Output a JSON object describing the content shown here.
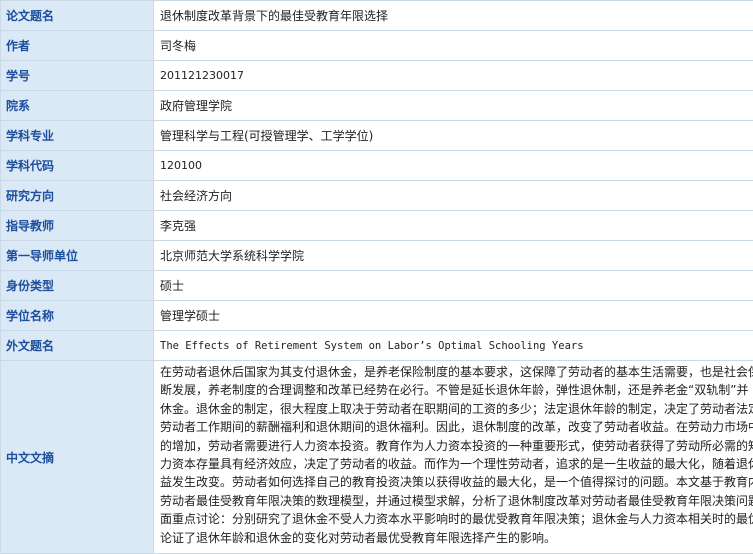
{
  "rows": [
    {
      "label": "论文题名",
      "value": "退休制度改革背景下的最佳受教育年限选择"
    },
    {
      "label": "作者",
      "value": "司冬梅"
    },
    {
      "label": "学号",
      "value": "201121230017"
    },
    {
      "label": "院系",
      "value": "政府管理学院"
    },
    {
      "label": "学科专业",
      "value": "管理科学与工程(可授管理学、工学学位)"
    },
    {
      "label": "学科代码",
      "value": "120100"
    },
    {
      "label": "研究方向",
      "value": "社会经济方向"
    },
    {
      "label": "指导教师",
      "value": "李克强"
    },
    {
      "label": "第一导师单位",
      "value": "北京师范大学系统科学学院"
    },
    {
      "label": "身份类型",
      "value": "硕士"
    },
    {
      "label": "学位名称",
      "value": "管理学硕士"
    },
    {
      "label": "外文题名",
      "value": "The Effects of Retirement System on Labor’s Optimal Schooling Years"
    }
  ],
  "abstract": {
    "label": "中文文摘",
    "text": "在劳动者退休后国家为其支付退休金，是养老保险制度的基本要求，这保障了劳动者的基本生活需要，也是社会保\n断发展，养老制度的合理调整和改革已经势在必行。不管是延长退休年龄，弹性退休制，还是养老金“双轨制”并\n休金。退休金的制定，很大程度上取决于劳动者在职期间的工资的多少；法定退休年龄的制定，决定了劳动者法定\n劳动者工作期间的薪酬福利和退休期间的退休福利。因此，退休制度的改革，改变了劳动者收益。在劳动力市场中\n的增加，劳动者需要进行人力资本投资。教育作为人力资本投资的一种重要形式，使劳动者获得了劳动所必需的知\n力资本存量具有经济效应，决定了劳动者的收益。而作为一个理性劳动者，追求的是一生收益的最大化，随着退休\n益发生改变。劳动者如何选择自己的教育投资决策以获得收益的最大化，是一个值得探讨的问题。本文基于教育内\n劳动者最佳受教育年限决策的数理模型，并通过模型求解，分析了退休制度改革对劳动者最佳受教育年限决策问题\n面重点讨论：分别研究了退休金不受人力资本水平影响时的最优受教育年限决策；退休金与人力资本相关时的最优\n论证了退休年龄和退休金的变化对劳动者最优受教育年限选择产生的影响。"
  }
}
